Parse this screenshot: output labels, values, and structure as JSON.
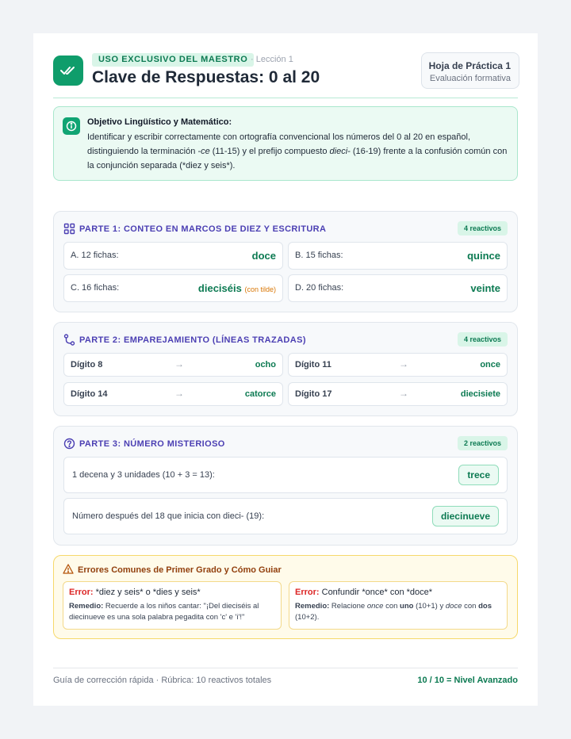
{
  "header": {
    "badge": "USO EXCLUSIVO DEL MAESTRO",
    "lesson": "· Lección 1",
    "title": "Clave de Respuestas: 0 al 20",
    "sheet_title": "Hoja de Práctica 1",
    "sheet_subtitle": "Evaluación formativa",
    "logo_icon": "double-check-icon"
  },
  "objective": {
    "title": "Objetivo Lingüístico y Matemático:",
    "text_1": "Identificar y escribir correctamente con ortografía convencional los números del 0 al 20 en español, distinguiendo la terminación ",
    "em_1": "-ce",
    "text_2": " (11-15) y el prefijo compuesto ",
    "em_2": "dieci-",
    "text_3": " (16-19) frente a la confusión común con la conjunción separada (*diez y seis*).",
    "icon": "info-icon"
  },
  "part1": {
    "title": "PARTE 1: CONTEO EN MARCOS DE DIEZ Y ESCRITURA",
    "badge": "4 reactivos",
    "icon": "grid-icon",
    "items": [
      {
        "label": "A. 12 fichas:",
        "answer": "doce",
        "note": ""
      },
      {
        "label": "B. 15 fichas:",
        "answer": "quince",
        "note": ""
      },
      {
        "label": "C. 16 fichas:",
        "answer": "dieciséis",
        "note": "(con tilde)"
      },
      {
        "label": "D. 20 fichas:",
        "answer": "veinte",
        "note": ""
      }
    ]
  },
  "part2": {
    "title": "PARTE 2: EMPAREJAMIENTO (LÍNEAS TRAZADAS)",
    "badge": "4 reactivos",
    "icon": "route-icon",
    "arrow": "→",
    "items": [
      {
        "label": "Dígito 8",
        "answer": "ocho"
      },
      {
        "label": "Dígito 11",
        "answer": "once"
      },
      {
        "label": "Dígito 14",
        "answer": "catorce"
      },
      {
        "label": "Dígito 17",
        "answer": "diecisiete"
      }
    ]
  },
  "part3": {
    "title": "PARTE 3: NÚMERO MISTERIOSO",
    "badge": "2 reactivos",
    "icon": "question-icon",
    "items": [
      {
        "text": "1 decena y 3 unidades (10 + 3 = 13):",
        "answer": "trece"
      },
      {
        "text": "Número después del 18 que inicia con dieci- (19):",
        "answer": "diecinueve"
      }
    ]
  },
  "errors": {
    "title": "Errores Comunes de Primer Grado y Cómo Guiar",
    "icon": "warning-icon",
    "error_label": "Error:",
    "remedy_label": "Remedio:",
    "card1": {
      "error": " *diez y seis* o *dies y seis*",
      "remedy": " Recuerde a los niños cantar: \"¡Del dieciséis al diecinueve es una sola palabra pegadita con 'c' e 'i'!\""
    },
    "card2": {
      "error": " Confundir *once* con *doce*",
      "remedy_1": " Relacione ",
      "remedy_em_1": "once",
      "remedy_2": " con ",
      "remedy_b_1": "uno",
      "remedy_3": " (10+1) y ",
      "remedy_em_2": "doce",
      "remedy_4": " con ",
      "remedy_b_2": "dos",
      "remedy_5": " (10+2)."
    }
  },
  "footer": {
    "left": "Guía de corrección rápida · Rúbrica: 10 reactivos totales",
    "right": "10 / 10 = Nivel Avanzado"
  },
  "colors": {
    "brand_green": "#0f9d6b",
    "section_title": "#4b3fb3",
    "error_red": "#dc2626",
    "warning_amber": "#92400e"
  }
}
